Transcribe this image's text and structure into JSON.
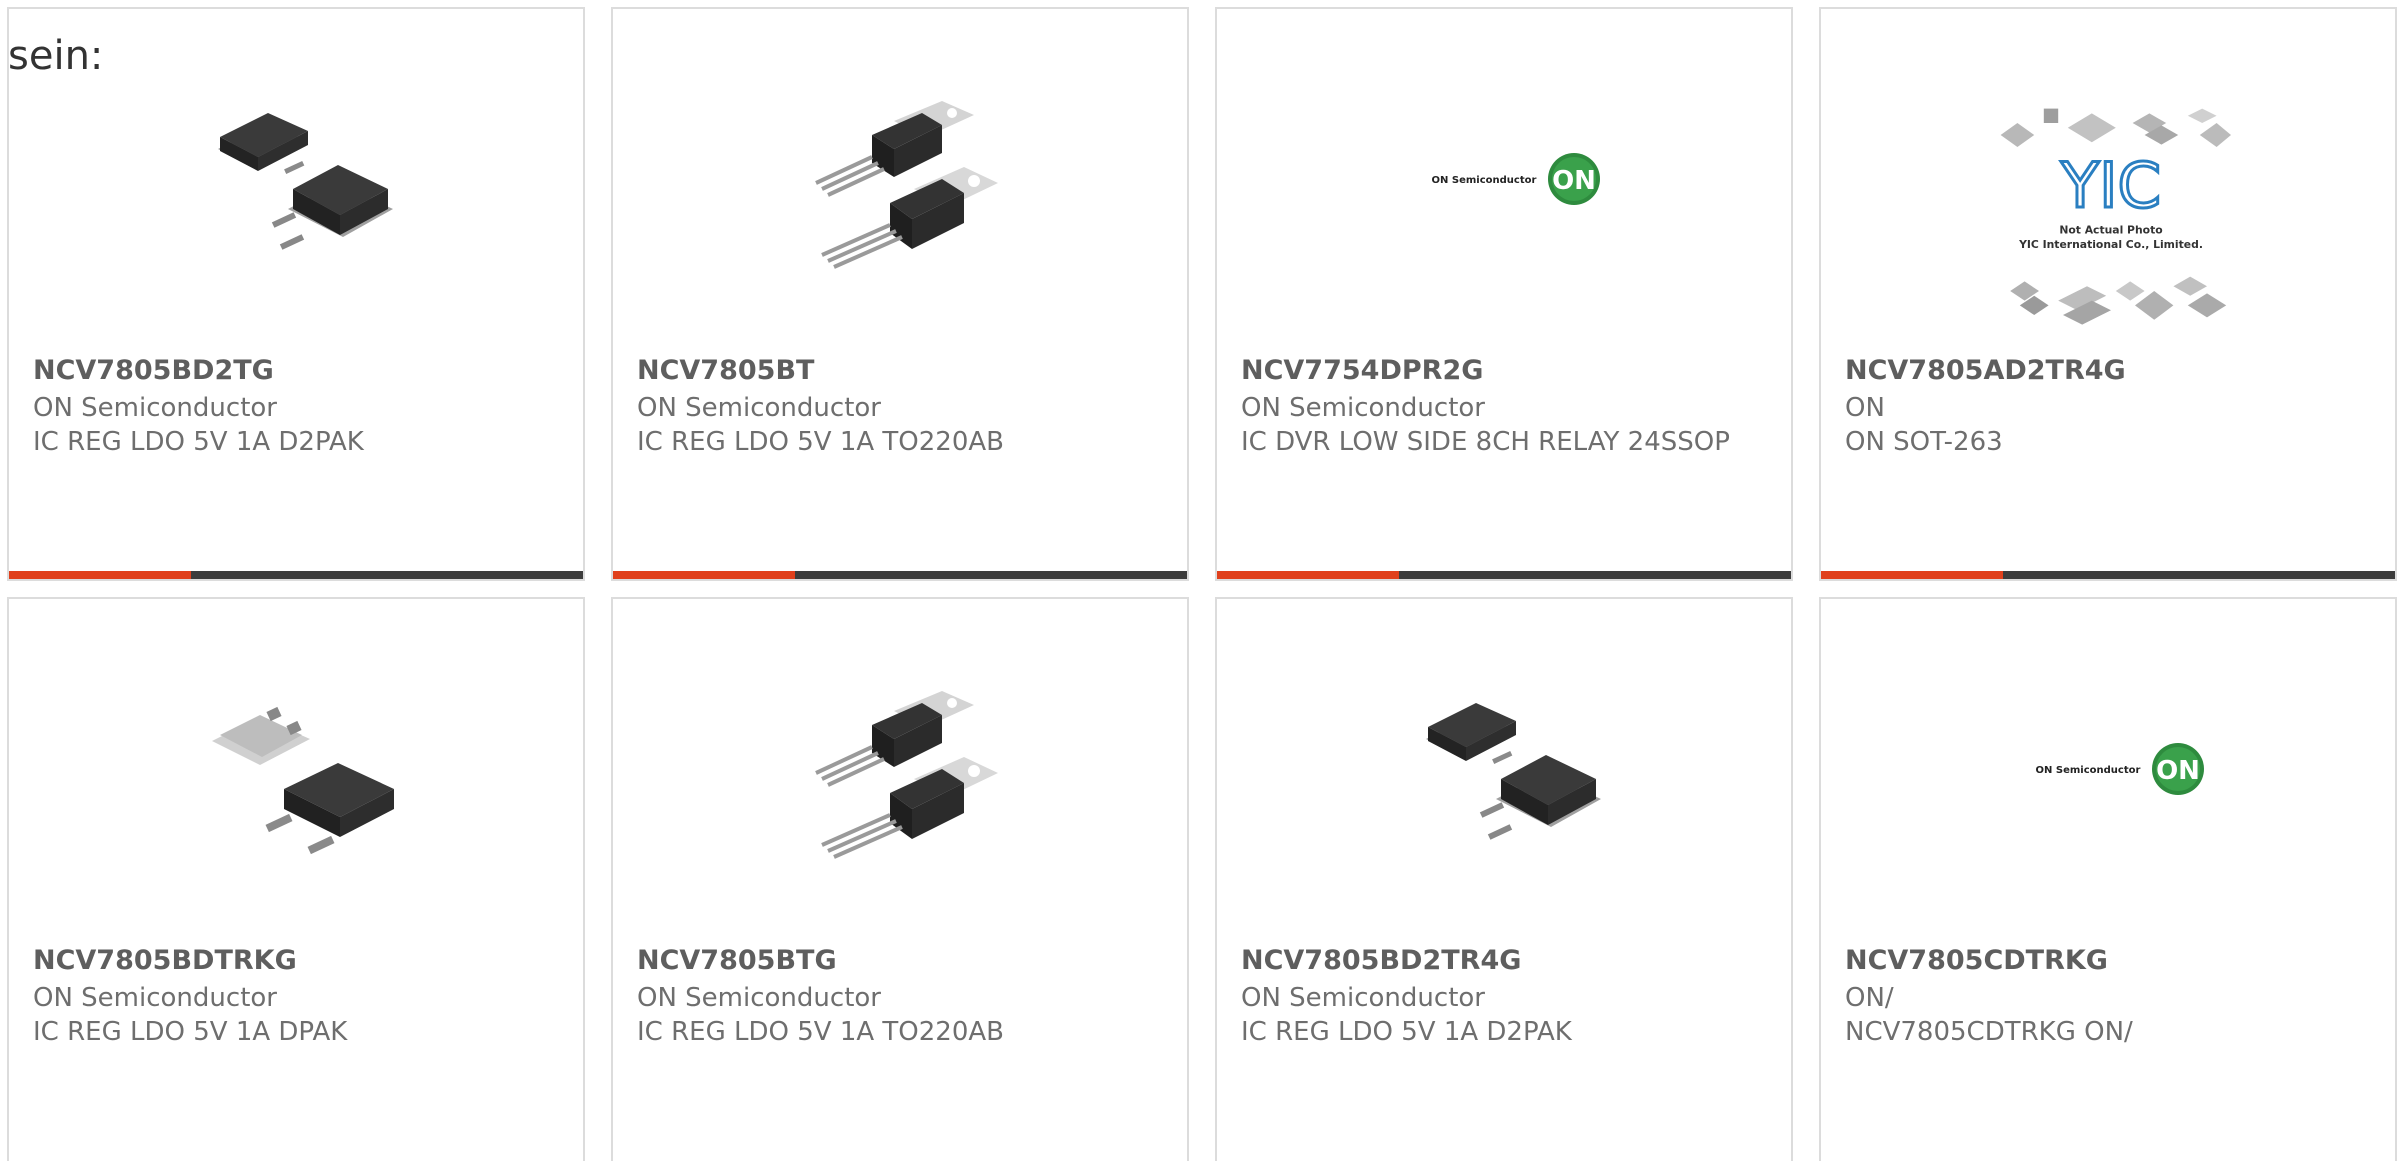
{
  "heading": "sein:",
  "colors": {
    "accent": "#e0401c",
    "bar": "#3c3c3c",
    "border": "#dcdcdc",
    "part_number": "#5e5e5e",
    "text": "#6e6e6e"
  },
  "products": [
    {
      "part_number": "NCV7805BD2TG",
      "manufacturer": "ON Semiconductor",
      "description": "IC REG LDO 5V 1A D2PAK",
      "image": "d2pak-package-icon"
    },
    {
      "part_number": "NCV7805BT",
      "manufacturer": "ON Semiconductor",
      "description": "IC REG LDO 5V 1A TO220AB",
      "image": "to220-package-icon"
    },
    {
      "part_number": "NCV7754DPR2G",
      "manufacturer": "ON Semiconductor",
      "description": "IC DVR LOW SIDE 8CH RELAY 24SSOP",
      "image": "on-semiconductor-logo"
    },
    {
      "part_number": "NCV7805AD2TR4G",
      "manufacturer": "ON",
      "description": "ON SOT-263",
      "image": "yic-placeholder-logo"
    },
    {
      "part_number": "NCV7805BDTRKG",
      "manufacturer": "ON Semiconductor",
      "description": "IC REG LDO 5V 1A DPAK",
      "image": "dpak-package-icon"
    },
    {
      "part_number": "NCV7805BTG",
      "manufacturer": "ON Semiconductor",
      "description": "IC REG LDO 5V 1A TO220AB",
      "image": "to220-package-icon"
    },
    {
      "part_number": "NCV7805BD2TR4G",
      "manufacturer": "ON Semiconductor",
      "description": "IC REG LDO 5V 1A D2PAK",
      "image": "d2pak-package-icon"
    },
    {
      "part_number": "NCV7805CDTRKG",
      "manufacturer": "ON/",
      "description": "NCV7805CDTRKG ON/",
      "image": "on-semiconductor-logo"
    }
  ],
  "logo_text": {
    "on_semiconductor": "ON Semiconductor",
    "on_badge": "ON",
    "yic_mark": "YIC",
    "yic_line1": "Not Actual Photo",
    "yic_line2": "YIC International Co., Limited."
  }
}
